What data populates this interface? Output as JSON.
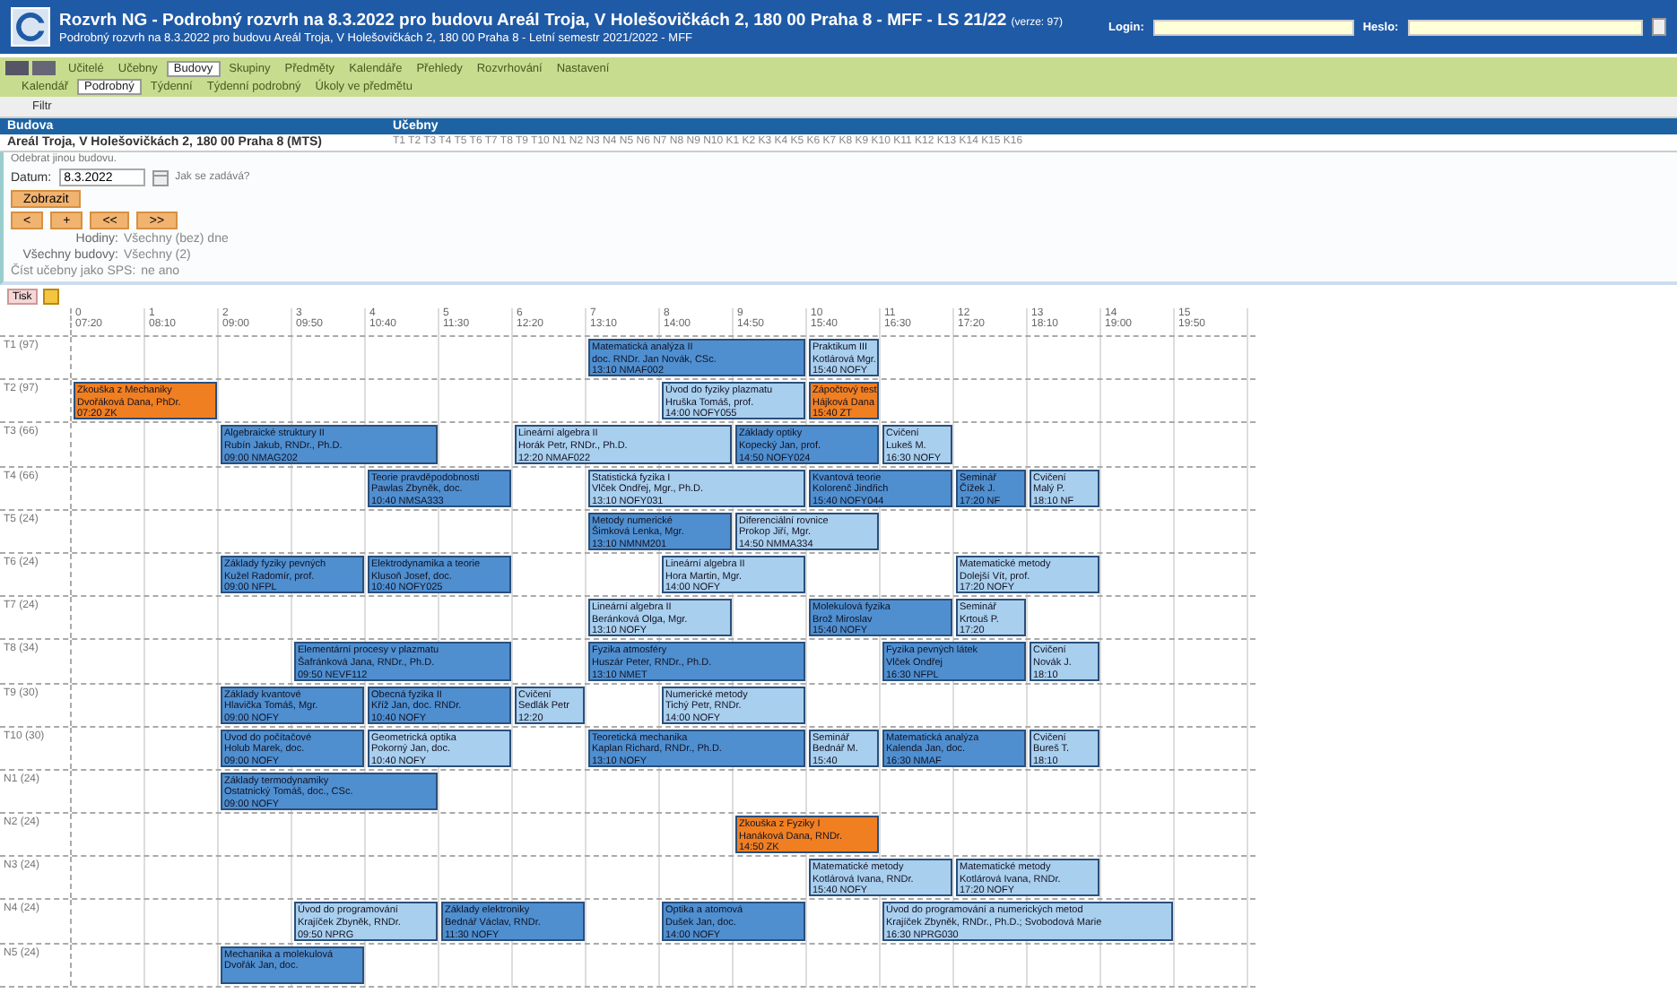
{
  "header": {
    "title": "Rozvrh NG - Podrobný rozvrh na 8.3.2022 pro budovu Areál Troja, V Holešovičkách 2, 180 00 Praha 8 - MFF - LS 21/22",
    "version": "(verze: 97)",
    "subtitle": "Podrobný rozvrh na 8.3.2022 pro budovu Areál Troja, V Holešovičkách 2, 180 00 Praha 8 - Letní semestr 2021/2022 - MFF",
    "login_label": "Login:",
    "password_label": "Heslo:"
  },
  "menu": [
    {
      "label": "Učitelé",
      "selected": false
    },
    {
      "label": "Učebny",
      "selected": false
    },
    {
      "label": "Budovy",
      "selected": true
    },
    {
      "label": "Skupiny",
      "selected": false
    },
    {
      "label": "Předměty",
      "selected": false
    },
    {
      "label": "Kalendáře",
      "selected": false
    },
    {
      "label": "Přehledy",
      "selected": false
    },
    {
      "label": "Rozvrhování",
      "selected": false
    },
    {
      "label": "Nastavení",
      "selected": false
    }
  ],
  "submenu": [
    {
      "label": "Kalendář",
      "selected": false
    },
    {
      "label": "Podrobný",
      "selected": true
    },
    {
      "label": "Týdenní",
      "selected": false
    },
    {
      "label": "Týdenní podrobný",
      "selected": false
    },
    {
      "label": "Úkoly ve předmětu",
      "selected": false
    }
  ],
  "filter": {
    "label": "Filtr",
    "columns": [
      "Budova",
      "Učebny"
    ],
    "building": "Areál Troja, V Holešovičkách 2, 180 00 Praha 8 (MTS)",
    "rooms": "T1 T2 T3 T4 T5 T6 T7 T8 T9 T10 N1 N2 N3 N4 N5 N6 N7 N8 N9 N10 K1 K2 K3 K4 K5 K6 K7 K8 K9 K10 K11 K12 K13 K14 K15 K16",
    "remove_link": "Odebrat jinou budovu.",
    "date_label": "Datum:",
    "date": "8.3.2022",
    "date_hint": "Jak se zadává?",
    "show_button": "Zobrazit",
    "nav_buttons": [
      "<",
      "+",
      "<<",
      ">>"
    ],
    "hours_label": "Hodiny:",
    "hours_value": "Všechny (bez) dne",
    "weeks_label": "Všechny budovy:",
    "weeks_value": "Všechny (2)",
    "sps_label": "Číst učebny jako SPS:",
    "sps_value": "ne ano"
  },
  "toolbar": [
    "Tisk"
  ],
  "periods": [
    {
      "number": "0",
      "time": "07:20"
    },
    {
      "number": "1",
      "time": "08:10"
    },
    {
      "number": "2",
      "time": "09:00"
    },
    {
      "number": "3",
      "time": "09:50"
    },
    {
      "number": "4",
      "time": "10:40"
    },
    {
      "number": "5",
      "time": "11:30"
    },
    {
      "number": "6",
      "time": "12:20"
    },
    {
      "number": "7",
      "time": "13:10"
    },
    {
      "number": "8",
      "time": "14:00"
    },
    {
      "number": "9",
      "time": "14:50"
    },
    {
      "number": "10",
      "time": "15:40"
    },
    {
      "number": "11",
      "time": "16:30"
    },
    {
      "number": "12",
      "time": "17:20"
    },
    {
      "number": "13",
      "time": "18:10"
    },
    {
      "number": "14",
      "time": "19:00"
    },
    {
      "number": "15",
      "time": "19:50"
    }
  ],
  "rooms": [
    {
      "label": "T1 (97)",
      "slots": [
        {
          "kind": "free"
        },
        {
          "kind": "free"
        },
        {
          "kind": "free"
        },
        {
          "kind": "free"
        },
        {
          "kind": "free"
        },
        {
          "kind": "free"
        },
        {
          "kind": "free"
        },
        {
          "kind": "event",
          "color": "#4f8fd0",
          "lines": [
            "Matematická analýza II",
            "doc. RNDr. Jan Novák, CSc.",
            "13:10 NMAF002"
          ]
        },
        {
          "kind": "continued"
        },
        {
          "kind": "continued"
        },
        {
          "kind": "event",
          "color": "#a9cfee",
          "lines": [
            "Praktikum III",
            "Kotlárová Mgr.",
            "15:40 NOFY"
          ]
        }
      ]
    },
    {
      "label": "T2 (97)",
      "slots": [
        {
          "kind": "event",
          "color": "#f07f22",
          "lines": [
            "Zkouška z Mechaniky",
            "Dvořáková Dana, PhDr.",
            "07:20 ZK"
          ]
        },
        {
          "kind": "continued"
        },
        {
          "kind": "free"
        },
        {
          "kind": "free"
        },
        {
          "kind": "free"
        },
        {
          "kind": "free"
        },
        {
          "kind": "free"
        },
        {
          "kind": "free"
        },
        {
          "kind": "event",
          "color": "#a9cfee",
          "lines": [
            "Úvod do fyziky plazmatu",
            "Hruška Tomáš, prof.",
            "14:00 NOFY055"
          ]
        },
        {
          "kind": "continued"
        },
        {
          "kind": "event",
          "color": "#f07f22",
          "lines": [
            "Zápočtový test",
            "Hájková Dana",
            "15:40 ZT"
          ]
        }
      ]
    },
    {
      "label": "T3 (66)",
      "slots": [
        {
          "kind": "free"
        },
        {
          "kind": "free"
        },
        {
          "kind": "event",
          "color": "#4f8fd0",
          "lines": [
            "Algebraické struktury II",
            "Rubín Jakub, RNDr., Ph.D.",
            "09:00 NMAG202"
          ]
        },
        {
          "kind": "continued"
        },
        {
          "kind": "continued"
        },
        {
          "kind": "free"
        },
        {
          "kind": "event",
          "color": "#a9cfee",
          "lines": [
            "Lineární algebra II",
            "Horák Petr, RNDr., Ph.D.",
            "12:20 NMAF022"
          ]
        },
        {
          "kind": "continued"
        },
        {
          "kind": "continued"
        },
        {
          "kind": "event",
          "color": "#4f8fd0",
          "lines": [
            "Základy optiky",
            "Kopecký Jan, prof.",
            "14:50 NOFY024"
          ]
        },
        {
          "kind": "continued"
        },
        {
          "kind": "event",
          "color": "#a9cfee",
          "lines": [
            "Cvičení",
            "Lukeš M.",
            "16:30 NOFY"
          ]
        }
      ]
    },
    {
      "label": "T4 (66)",
      "slots": [
        {
          "kind": "free"
        },
        {
          "kind": "free"
        },
        {
          "kind": "free"
        },
        {
          "kind": "free"
        },
        {
          "kind": "event",
          "color": "#4f8fd0",
          "lines": [
            "Teorie pravděpodobnosti",
            "Pawlas Zbyněk, doc.",
            "10:40 NMSA333"
          ]
        },
        {
          "kind": "continued"
        },
        {
          "kind": "free"
        },
        {
          "kind": "event",
          "color": "#a9cfee",
          "lines": [
            "Statistická fyzika I",
            "Vlček Ondřej, Mgr., Ph.D.",
            "13:10 NOFY031"
          ]
        },
        {
          "kind": "continued"
        },
        {
          "kind": "continued"
        },
        {
          "kind": "event",
          "color": "#4f8fd0",
          "lines": [
            "Kvantová teorie",
            "Kolorenč Jindřich",
            "15:40 NOFY044"
          ]
        },
        {
          "kind": "continued"
        },
        {
          "kind": "event",
          "color": "#4f8fd0",
          "lines": [
            "Seminář",
            "Čížek J.",
            "17:20 NF"
          ]
        },
        {
          "kind": "event",
          "color": "#a9cfee",
          "lines": [
            "Cvičení",
            "Malý P.",
            "18:10 NF"
          ]
        }
      ]
    },
    {
      "label": "T5 (24)",
      "slots": [
        {
          "kind": "free"
        },
        {
          "kind": "free"
        },
        {
          "kind": "free"
        },
        {
          "kind": "free"
        },
        {
          "kind": "free"
        },
        {
          "kind": "free"
        },
        {
          "kind": "free"
        },
        {
          "kind": "event",
          "color": "#4f8fd0",
          "lines": [
            "Metody numerické",
            "Šimková Lenka, Mgr.",
            "13:10 NMNM201"
          ]
        },
        {
          "kind": "continued"
        },
        {
          "kind": "event",
          "color": "#a9cfee",
          "lines": [
            "Diferenciální rovnice",
            "Prokop Jiří, Mgr.",
            "14:50 NMMA334"
          ]
        },
        {
          "kind": "continued"
        }
      ]
    },
    {
      "label": "T6 (24)",
      "slots": [
        {
          "kind": "free"
        },
        {
          "kind": "free"
        },
        {
          "kind": "event",
          "color": "#4f8fd0",
          "lines": [
            "Základy fyziky pevných",
            "Kužel Radomír, prof.",
            "09:00 NFPL"
          ]
        },
        {
          "kind": "continued"
        },
        {
          "kind": "event",
          "color": "#4f8fd0",
          "lines": [
            "Elektrodynamika a teorie",
            "Klusoň Josef, doc.",
            "10:40 NOFY025"
          ]
        },
        {
          "kind": "continued"
        },
        {
          "kind": "free"
        },
        {
          "kind": "free"
        },
        {
          "kind": "event",
          "color": "#a9cfee",
          "lines": [
            "Lineární algebra II",
            "Hora Martin, Mgr.",
            "14:00 NOFY"
          ]
        },
        {
          "kind": "continued"
        },
        {
          "kind": "free"
        },
        {
          "kind": "free"
        },
        {
          "kind": "event",
          "color": "#a9cfee",
          "lines": [
            "Matematické metody",
            "Dolejší Vít, prof.",
            "17:20 NOFY"
          ]
        },
        {
          "kind": "continued"
        }
      ]
    },
    {
      "label": "T7 (24)",
      "slots": [
        {
          "kind": "free"
        },
        {
          "kind": "free"
        },
        {
          "kind": "free"
        },
        {
          "kind": "free"
        },
        {
          "kind": "free"
        },
        {
          "kind": "free"
        },
        {
          "kind": "free"
        },
        {
          "kind": "event",
          "color": "#a9cfee",
          "lines": [
            "Lineární algebra II",
            "Beránková Olga, Mgr.",
            "13:10 NOFY"
          ]
        },
        {
          "kind": "continued"
        },
        {
          "kind": "free"
        },
        {
          "kind": "event",
          "color": "#4f8fd0",
          "lines": [
            "Molekulová fyzika",
            "Brož Miroslav",
            "15:40 NOFY"
          ]
        },
        {
          "kind": "continued"
        },
        {
          "kind": "event",
          "color": "#a9cfee",
          "lines": [
            "Seminář",
            "Krtouš P.",
            "17:20"
          ]
        }
      ]
    },
    {
      "label": "T8 (34)",
      "slots": [
        {
          "kind": "free"
        },
        {
          "kind": "free"
        },
        {
          "kind": "free"
        },
        {
          "kind": "event",
          "color": "#4f8fd0",
          "lines": [
            "Elementární procesy v plazmatu",
            "Šafránková Jana, RNDr., Ph.D.",
            "09:50 NEVF112"
          ]
        },
        {
          "kind": "continued"
        },
        {
          "kind": "continued"
        },
        {
          "kind": "free"
        },
        {
          "kind": "event",
          "color": "#4f8fd0",
          "lines": [
            "Fyzika atmosféry",
            "Huszár Peter, RNDr., Ph.D.",
            "13:10 NMET"
          ]
        },
        {
          "kind": "continued"
        },
        {
          "kind": "continued"
        },
        {
          "kind": "free"
        },
        {
          "kind": "event",
          "color": "#4f8fd0",
          "lines": [
            "Fyzika pevných látek",
            "Vlček Ondřej",
            "16:30 NFPL"
          ]
        },
        {
          "kind": "continued"
        },
        {
          "kind": "event",
          "color": "#a9cfee",
          "lines": [
            "Cvičení",
            "Novák J.",
            "18:10"
          ]
        }
      ]
    },
    {
      "label": "T9 (30)",
      "slots": [
        {
          "kind": "free"
        },
        {
          "kind": "free"
        },
        {
          "kind": "event",
          "color": "#4f8fd0",
          "lines": [
            "Základy kvantové",
            "Hlavička Tomáš, Mgr.",
            "09:00 NOFY"
          ]
        },
        {
          "kind": "continued"
        },
        {
          "kind": "event",
          "color": "#4f8fd0",
          "lines": [
            "Obecná fyzika II",
            "Kříž Jan, doc. RNDr.",
            "10:40 NOFY"
          ]
        },
        {
          "kind": "continued"
        },
        {
          "kind": "event",
          "color": "#a9cfee",
          "lines": [
            "Cvičení",
            "Sedlák Petr",
            "12:20"
          ]
        },
        {
          "kind": "free"
        },
        {
          "kind": "event",
          "color": "#a9cfee",
          "lines": [
            "Numerické metody",
            "Tichý Petr, RNDr.",
            "14:00 NOFY"
          ]
        },
        {
          "kind": "continued"
        }
      ]
    },
    {
      "label": "T10 (30)",
      "slots": [
        {
          "kind": "free"
        },
        {
          "kind": "free"
        },
        {
          "kind": "event",
          "color": "#4f8fd0",
          "lines": [
            "Úvod do počítačové",
            "Holub Marek, doc.",
            "09:00 NOFY"
          ]
        },
        {
          "kind": "continued"
        },
        {
          "kind": "event",
          "color": "#a9cfee",
          "lines": [
            "Geometrická optika",
            "Pokorný Jan, doc.",
            "10:40 NOFY"
          ]
        },
        {
          "kind": "continued"
        },
        {
          "kind": "free"
        },
        {
          "kind": "event",
          "color": "#4f8fd0",
          "lines": [
            "Teoretická mechanika",
            "Kaplan Richard, RNDr., Ph.D.",
            "13:10 NOFY"
          ]
        },
        {
          "kind": "continued"
        },
        {
          "kind": "continued"
        },
        {
          "kind": "event",
          "color": "#a9cfee",
          "lines": [
            "Seminář",
            "Bednář M.",
            "15:40"
          ]
        },
        {
          "kind": "event",
          "color": "#4f8fd0",
          "lines": [
            "Matematická analýza",
            "Kalenda Jan, doc.",
            "16:30 NMAF"
          ]
        },
        {
          "kind": "continued"
        },
        {
          "kind": "event",
          "color": "#a9cfee",
          "lines": [
            "Cvičení",
            "Bureš T.",
            "18:10"
          ]
        }
      ]
    },
    {
      "label": "N1 (24)",
      "slots": [
        {
          "kind": "free"
        },
        {
          "kind": "free"
        },
        {
          "kind": "event",
          "color": "#4f8fd0",
          "lines": [
            "Základy termodynamiky",
            "Ostatnický Tomáš, doc., CSc.",
            "09:00 NOFY"
          ]
        },
        {
          "kind": "continued"
        },
        {
          "kind": "continued"
        }
      ]
    },
    {
      "label": "N2 (24)",
      "slots": [
        {
          "kind": "free"
        },
        {
          "kind": "free"
        },
        {
          "kind": "free"
        },
        {
          "kind": "free"
        },
        {
          "kind": "free"
        },
        {
          "kind": "free"
        },
        {
          "kind": "free"
        },
        {
          "kind": "free"
        },
        {
          "kind": "free"
        },
        {
          "kind": "event",
          "color": "#f07f22",
          "lines": [
            "Zkouška z Fyziky I",
            "Hanáková Dana, RNDr.",
            "14:50 ZK"
          ]
        },
        {
          "kind": "continued"
        }
      ]
    },
    {
      "label": "N3 (24)",
      "slots": [
        {
          "kind": "free"
        },
        {
          "kind": "free"
        },
        {
          "kind": "free"
        },
        {
          "kind": "free"
        },
        {
          "kind": "free"
        },
        {
          "kind": "free"
        },
        {
          "kind": "free"
        },
        {
          "kind": "free"
        },
        {
          "kind": "free"
        },
        {
          "kind": "free"
        },
        {
          "kind": "event",
          "color": "#a9cfee",
          "lines": [
            "Matematické metody",
            "Kotlárová Ivana, RNDr.",
            "15:40 NOFY"
          ]
        },
        {
          "kind": "continued"
        },
        {
          "kind": "event",
          "color": "#a9cfee",
          "lines": [
            "Matematické metody",
            "Kotlárová Ivana, RNDr.",
            "17:20 NOFY"
          ]
        },
        {
          "kind": "continued"
        }
      ]
    },
    {
      "label": "N4 (24)",
      "slots": [
        {
          "kind": "free"
        },
        {
          "kind": "free"
        },
        {
          "kind": "free"
        },
        {
          "kind": "event",
          "color": "#a9cfee",
          "lines": [
            "Úvod do programování",
            "Krajíček Zbyněk, RNDr.",
            "09:50 NPRG"
          ]
        },
        {
          "kind": "continued"
        },
        {
          "kind": "event",
          "color": "#4f8fd0",
          "lines": [
            "Základy elektroniky",
            "Bednář Václav, RNDr.",
            "11:30 NOFY"
          ]
        },
        {
          "kind": "continued"
        },
        {
          "kind": "free"
        },
        {
          "kind": "event",
          "color": "#4f8fd0",
          "lines": [
            "Optika a atomová",
            "Dušek Jan, doc.",
            "14:00 NOFY"
          ]
        },
        {
          "kind": "continued"
        },
        {
          "kind": "free"
        },
        {
          "kind": "event",
          "color": "#a9cfee",
          "lines": [
            "Úvod do programování a numerických metod",
            "Krajíček Zbyněk, RNDr., Ph.D.; Svobodová Marie",
            "16:30 NPRG030"
          ]
        },
        {
          "kind": "continued"
        },
        {
          "kind": "continued"
        },
        {
          "kind": "continued"
        }
      ]
    },
    {
      "label": "N5 (24)",
      "slots": [
        {
          "kind": "free"
        },
        {
          "kind": "free"
        },
        {
          "kind": "event",
          "color": "#4f8fd0",
          "lines": [
            "Mechanika a molekulová",
            "Dvořák Jan, doc."
          ]
        },
        {
          "kind": "continued"
        }
      ]
    }
  ]
}
